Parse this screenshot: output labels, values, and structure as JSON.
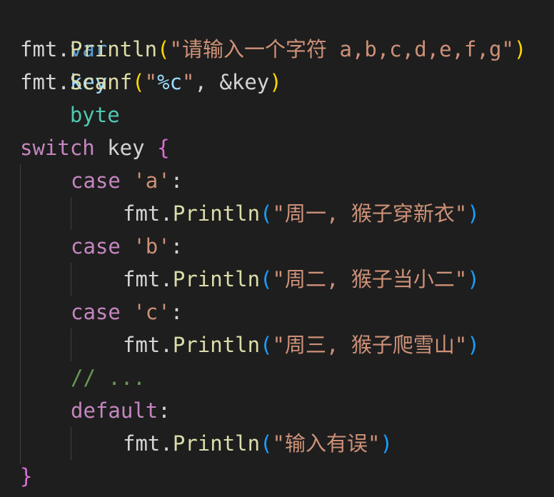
{
  "code": {
    "l1": {
      "kw": "var",
      "name": "key",
      "type": "byte"
    },
    "l2": {
      "pkg": "fmt",
      "dot": ".",
      "fn": "Println",
      "open": "(",
      "str": "\"请输入一个字符 a,b,c,d,e,f,g\"",
      "close": ")"
    },
    "l3": {
      "pkg": "fmt",
      "dot": ".",
      "fn": "Scanf",
      "open": "(",
      "q1": "\"",
      "fmt": "%c",
      "q2": "\"",
      "rest": ", &key",
      "close": ")"
    },
    "l5": {
      "kw": "switch",
      "name": " key ",
      "brace": "{"
    },
    "l6": {
      "kw": "case",
      "str": "'a'",
      "colon": ":"
    },
    "l7": {
      "pkg": "fmt",
      "dot": ".",
      "fn": "Println",
      "open": "(",
      "str": "\"周一, 猴子穿新衣\"",
      "close": ")"
    },
    "l8": {
      "kw": "case",
      "str": "'b'",
      "colon": ":"
    },
    "l9": {
      "pkg": "fmt",
      "dot": ".",
      "fn": "Println",
      "open": "(",
      "str": "\"周二, 猴子当小二\"",
      "close": ")"
    },
    "l10": {
      "kw": "case",
      "str": "'c'",
      "colon": ":"
    },
    "l11": {
      "pkg": "fmt",
      "dot": ".",
      "fn": "Println",
      "open": "(",
      "str": "\"周三, 猴子爬雪山\"",
      "close": ")"
    },
    "l12": {
      "comment": "// ..."
    },
    "l13": {
      "kw": "default",
      "colon": ":"
    },
    "l14": {
      "pkg": "fmt",
      "dot": ".",
      "fn": "Println",
      "open": "(",
      "str": "\"输入有误\"",
      "close": ")"
    },
    "l15": {
      "brace": "}"
    }
  }
}
